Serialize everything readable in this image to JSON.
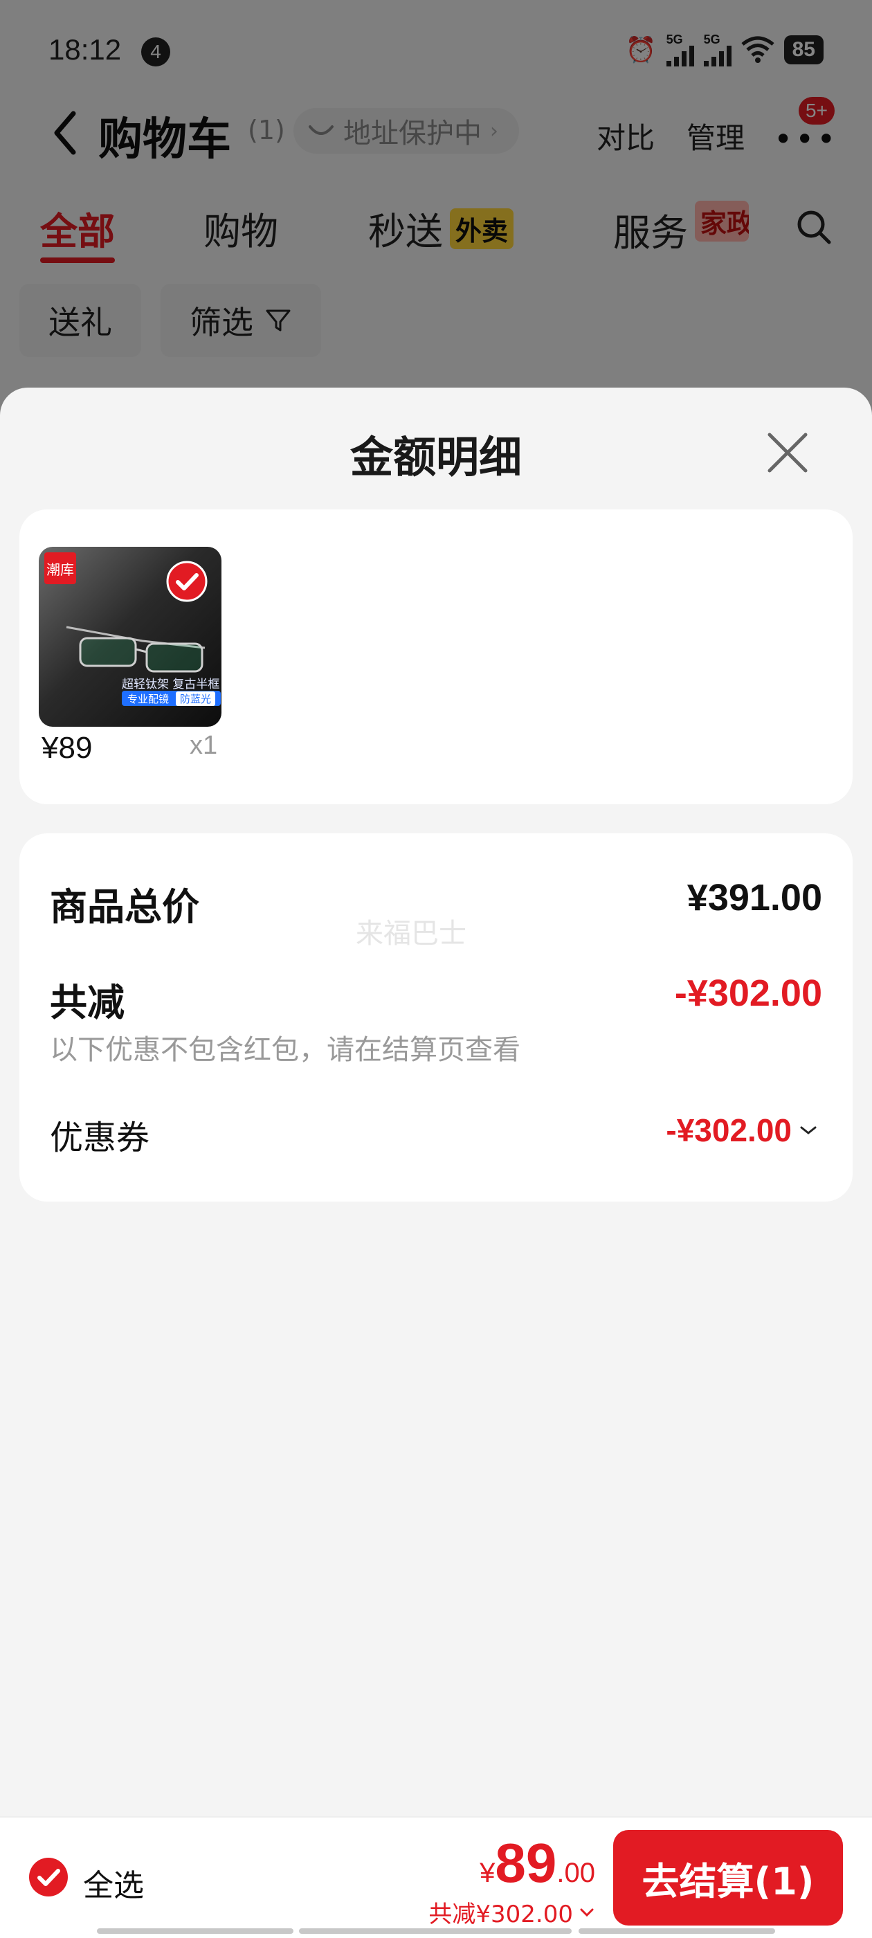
{
  "status_bar": {
    "time": "18:12",
    "notification_count": "4",
    "network_labels": [
      "5G",
      "5G"
    ],
    "battery": "85",
    "icons": [
      "alarm-icon",
      "signal-icon",
      "signal-icon",
      "wifi-icon",
      "battery-icon"
    ]
  },
  "nav": {
    "title": "购物车",
    "count": "(1)",
    "address_protection": "地址保护中",
    "compare_label": "对比",
    "manage_label": "管理",
    "more_badge": "5+"
  },
  "tabs": [
    {
      "label": "全部",
      "active": true
    },
    {
      "label": "购物",
      "active": false
    },
    {
      "label": "秒送",
      "tag": "外卖",
      "active": false
    },
    {
      "label": "服务",
      "tag": "家政",
      "active": false
    }
  ],
  "chips": [
    {
      "label": "送礼"
    },
    {
      "label": "筛选"
    }
  ],
  "sheet": {
    "title": "金额明细",
    "items": [
      {
        "price": "¥89",
        "quantity": "x1",
        "thumb_brand": "潮库",
        "thumb_caption": "超轻钛架 复古半框",
        "thumb_bar_left": "专业配镜",
        "thumb_bar_pill": "防蓝光",
        "selected": true
      }
    ],
    "summary": {
      "total_label": "商品总价",
      "total_value": "¥391.00",
      "watermark": "来福巴士",
      "reduce_label": "共减",
      "reduce_value": "-¥302.00",
      "note": "以下优惠不包含红包，请在结算页查看",
      "coupon_label": "优惠券",
      "coupon_value": "-¥302.00"
    }
  },
  "bottom_bar": {
    "select_all_label": "全选",
    "price_currency": "¥",
    "price_integer": "89",
    "price_decimal": ".00",
    "reduce_text": "共减¥302.00",
    "checkout_label": "去结算(1)"
  },
  "colors": {
    "accent_red": "#e21b23",
    "tag_yellow": "#ffd53a",
    "background": "#f4f4f4"
  }
}
